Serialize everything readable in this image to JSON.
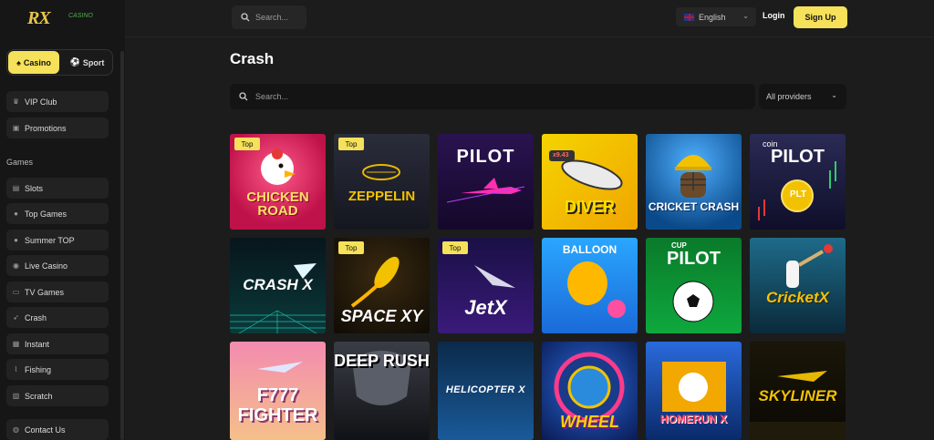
{
  "brand": {
    "logo_text": "RX",
    "logo_sub": "CASINO"
  },
  "toggle": {
    "casino": "Casino",
    "sport": "Sport"
  },
  "nav_top": [
    {
      "label": "VIP Club",
      "icon": "crown-icon"
    },
    {
      "label": "Promotions",
      "icon": "gift-icon"
    }
  ],
  "games_label": "Games",
  "nav_games": [
    {
      "label": "Slots",
      "icon": "slots-icon"
    },
    {
      "label": "Top Games",
      "icon": "star-icon"
    },
    {
      "label": "Summer TOP",
      "icon": "sun-icon"
    },
    {
      "label": "Live Casino",
      "icon": "live-icon"
    },
    {
      "label": "TV Games",
      "icon": "tv-icon"
    },
    {
      "label": "Crash",
      "icon": "rocket-icon"
    },
    {
      "label": "Instant",
      "icon": "grid-icon"
    },
    {
      "label": "Fishing",
      "icon": "fish-icon"
    },
    {
      "label": "Scratch",
      "icon": "scratch-icon"
    }
  ],
  "contact": {
    "label": "Contact Us",
    "icon": "chat-icon"
  },
  "header": {
    "search_placeholder": "Search...",
    "language": "English",
    "login": "Login",
    "signup": "Sign Up"
  },
  "page": {
    "title": "Crash",
    "search_placeholder": "Search...",
    "providers": "All providers"
  },
  "badge_label": "Top",
  "games": [
    {
      "title": "CHICKEN ROAD",
      "top": true
    },
    {
      "title": "ZEPPELIN",
      "top": true
    },
    {
      "title": "PILOT",
      "top": false
    },
    {
      "title": "DIVER",
      "top": false,
      "sub": "x9.43"
    },
    {
      "title": "CRICKET CRASH",
      "top": false
    },
    {
      "title": "PILOT",
      "top": false,
      "sub": "coin",
      "extra": "PLT"
    },
    {
      "title": "CRASH X",
      "top": false
    },
    {
      "title": "SPACE XY",
      "top": true
    },
    {
      "title": "JetX",
      "top": true
    },
    {
      "title": "BALLOON",
      "top": false
    },
    {
      "title": "PILOT",
      "top": false,
      "sub": "CUP"
    },
    {
      "title": "CricketX",
      "top": false
    },
    {
      "title": "F777 FIGHTER",
      "top": false
    },
    {
      "title": "DEEP RUSH",
      "top": false
    },
    {
      "title": "HELICOPTER X",
      "top": false
    },
    {
      "title": "WHEEL",
      "top": false
    },
    {
      "title": "HOMERUN X",
      "top": false
    },
    {
      "title": "SKYLINER",
      "top": false
    }
  ]
}
